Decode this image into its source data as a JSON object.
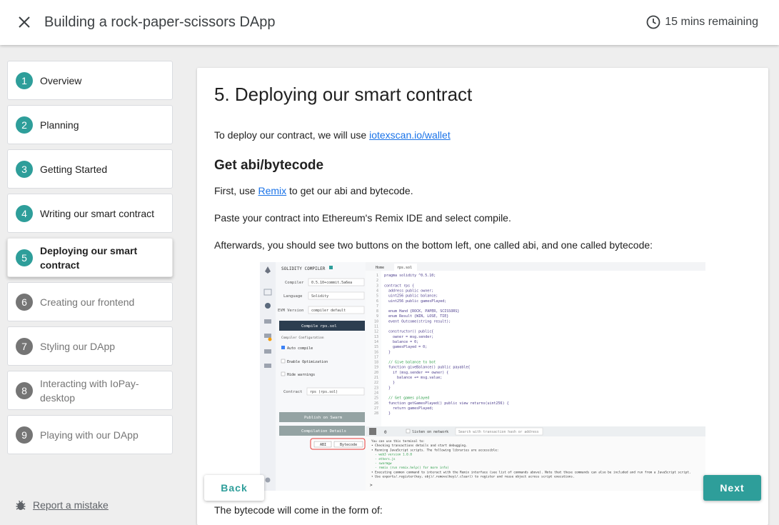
{
  "header": {
    "title": "Building a rock-paper-scissors DApp",
    "time_remaining": "15 mins remaining",
    "close_icon": "close-icon",
    "clock_icon": "clock-icon"
  },
  "sidebar": {
    "steps": [
      {
        "num": "1",
        "label": "Overview",
        "state": "done"
      },
      {
        "num": "2",
        "label": "Planning",
        "state": "done"
      },
      {
        "num": "3",
        "label": "Getting Started",
        "state": "done"
      },
      {
        "num": "4",
        "label": "Writing our smart contract",
        "state": "done"
      },
      {
        "num": "5",
        "label": "Deploying our smart contract",
        "state": "active"
      },
      {
        "num": "6",
        "label": "Creating our frontend",
        "state": "todo"
      },
      {
        "num": "7",
        "label": "Styling our DApp",
        "state": "todo"
      },
      {
        "num": "8",
        "label": "Interacting with IoPay-desktop",
        "state": "todo"
      },
      {
        "num": "9",
        "label": "Playing with our DApp",
        "state": "todo"
      }
    ],
    "report_label": "Report a mistake",
    "report_icon": "bug-icon"
  },
  "content": {
    "heading": "5. Deploying our smart contract",
    "intro_text": "To deploy our contract, we will use ",
    "intro_link": "iotexscan.io/wallet",
    "subheading": "Get abi/bytecode",
    "first_pre": "First, use ",
    "first_link": "Remix",
    "first_post": " to get our abi and bytecode.",
    "paste_text": "Paste your contract into Ethereum's Remix IDE and select compile.",
    "after_text": "Afterwards, you should see two buttons on the bottom left, one called abi, and one called bytecode:",
    "bytecode_text": "The bytecode will come in the form of:"
  },
  "remix": {
    "compiler_title": "SOLIDITY COMPILER",
    "compiler_label": "Compiler",
    "compiler_value": "0.5.10+commit.5a6ea",
    "language_label": "Language",
    "language_value": "Solidity",
    "evm_label": "EVM Version",
    "evm_value": "compiler default",
    "compile_button": "Compile rps.sol",
    "config_label": "Compiler Configuration",
    "auto_compile": "Auto compile",
    "enable_opt": "Enable Optimization",
    "hide_warnings": "Hide warnings",
    "contract_label": "Contract",
    "contract_value": "rps (rps.sol)",
    "publish_button": "Publish on Swarm",
    "details_button": "Compilation Details",
    "abi_button": "ABI",
    "bytecode_button": "Bytecode",
    "tab_home": "Home",
    "tab_file": "rps.sol",
    "listen_label": "listen on network",
    "search_placeholder": "Search with transaction hash or address",
    "code_lines": [
      {
        "n": "1",
        "t": "pragma solidity ^0.5.10;"
      },
      {
        "n": "2",
        "t": ""
      },
      {
        "n": "3",
        "t": "contract rps {"
      },
      {
        "n": "4",
        "t": "  address public owner;"
      },
      {
        "n": "5",
        "t": "  uint256 public balance;"
      },
      {
        "n": "6",
        "t": "  uint256 public gamesPlayed;"
      },
      {
        "n": "7",
        "t": ""
      },
      {
        "n": "8",
        "t": "  enum Hand {ROCK, PAPER, SCISSORS}"
      },
      {
        "n": "9",
        "t": "  enum Result {WIN, LOSE, TIE}"
      },
      {
        "n": "10",
        "t": "  event Outcome(string result);"
      },
      {
        "n": "11",
        "t": ""
      },
      {
        "n": "12",
        "t": "  constructor() public{"
      },
      {
        "n": "13",
        "t": "    owner = msg.sender;"
      },
      {
        "n": "14",
        "t": "    balance = 0;"
      },
      {
        "n": "15",
        "t": "    gamesPlayed = 0;"
      },
      {
        "n": "16",
        "t": "  }"
      },
      {
        "n": "17",
        "t": ""
      },
      {
        "n": "18",
        "t": "  // Give balance to bot"
      },
      {
        "n": "19",
        "t": "  function giveBalance() public payable{"
      },
      {
        "n": "20",
        "t": "    if (msg.sender == owner) {"
      },
      {
        "n": "21",
        "t": "      balance += msg.value;"
      },
      {
        "n": "22",
        "t": "    }"
      },
      {
        "n": "23",
        "t": "  }"
      },
      {
        "n": "24",
        "t": ""
      },
      {
        "n": "25",
        "t": "  // Get games played"
      },
      {
        "n": "26",
        "t": "  function getGamesPlayed() public view returns(uint256) {"
      },
      {
        "n": "27",
        "t": "    return gamesPlayed;"
      },
      {
        "n": "28",
        "t": "  }"
      }
    ],
    "console_lines": [
      "You can use this terminal to:",
      "• Checking transactions details and start debugging.",
      "• Running JavaScript scripts. The following libraries are accessible:",
      "  - web3 version 1.0.0",
      "  - ethers.js",
      "  - swarmgw",
      "  - remix (run remix.help() for more info)",
      "• Executing common command to interact with the Remix interface (see list of commands above). Note that these commands can also be included and run from a JavaScript script.",
      "• Use exports/.register(key, obj)/.remove(key)/.clear() to register and reuse object across script executions."
    ],
    "prompt": ">"
  },
  "nav": {
    "back_label": "Back",
    "next_label": "Next"
  },
  "colors": {
    "accent": "#2e9e9a",
    "link": "#1a73e8",
    "inactive": "#757575"
  }
}
